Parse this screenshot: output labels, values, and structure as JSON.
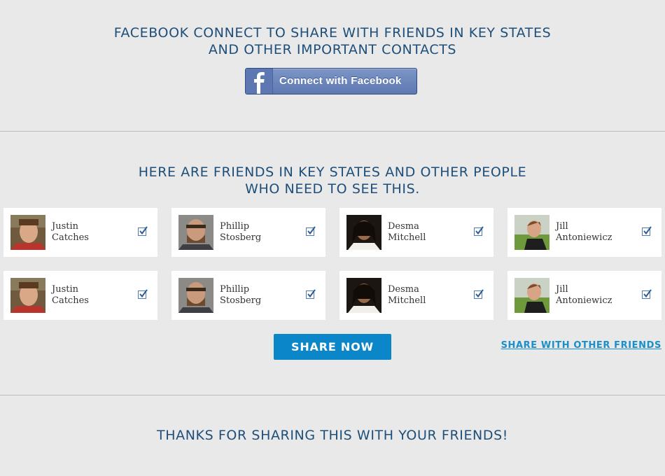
{
  "connect_section": {
    "heading_line1": "FACEBOOK CONNECT TO SHARE WITH FRIENDS IN KEY STATES",
    "heading_line2": "AND OTHER IMPORTANT CONTACTS",
    "button_label": "Connect with Facebook",
    "button_icon": "facebook-logo-icon"
  },
  "friends_section": {
    "heading_line1": "HERE ARE FRIENDS IN KEY STATES AND OTHER PEOPLE",
    "heading_line2": "WHO NEED TO SEE THIS.",
    "friends": [
      {
        "first": "Justin",
        "last": "Catches",
        "checked": true
      },
      {
        "first": "Phillip",
        "last": "Stosberg",
        "checked": true
      },
      {
        "first": "Desma",
        "last": "Mitchell",
        "checked": true
      },
      {
        "first": "Jill",
        "last": "Antoniewicz",
        "checked": true
      },
      {
        "first": "Justin",
        "last": "Catches",
        "checked": true
      },
      {
        "first": "Phillip",
        "last": "Stosberg",
        "checked": true
      },
      {
        "first": "Desma",
        "last": "Mitchell",
        "checked": true
      },
      {
        "first": "Jill",
        "last": "Antoniewicz",
        "checked": true
      }
    ],
    "share_button_label": "SHARE NOW",
    "other_friends_link": "SHARE WITH OTHER FRIENDS"
  },
  "thanks_section": {
    "message": "THANKS FOR SHARING THIS WITH YOUR FRIENDS!"
  },
  "colors": {
    "background": "#e9e9e9",
    "heading": "#1e4f7a",
    "facebook_button": "#6c85bb",
    "share_button": "#0b86c8",
    "link": "#1a8fc9"
  }
}
